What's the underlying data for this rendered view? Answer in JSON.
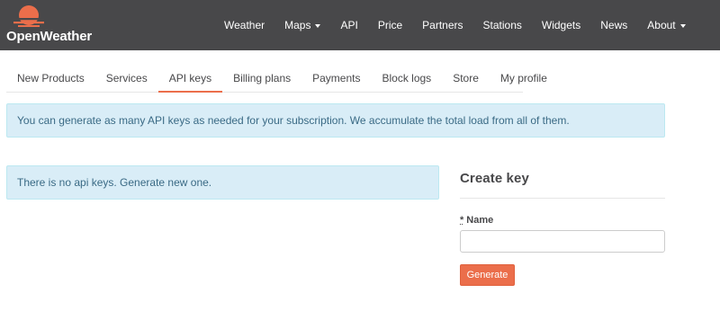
{
  "brand": {
    "name": "OpenWeather",
    "accent_color": "#eb6e4b",
    "header_bg": "#48484a"
  },
  "nav": {
    "items": [
      {
        "label": "Weather",
        "dropdown": false
      },
      {
        "label": "Maps",
        "dropdown": true
      },
      {
        "label": "API",
        "dropdown": false
      },
      {
        "label": "Price",
        "dropdown": false
      },
      {
        "label": "Partners",
        "dropdown": false
      },
      {
        "label": "Stations",
        "dropdown": false
      },
      {
        "label": "Widgets",
        "dropdown": false
      },
      {
        "label": "News",
        "dropdown": false
      },
      {
        "label": "About",
        "dropdown": true
      }
    ]
  },
  "tabs": {
    "active": "API keys",
    "items": [
      {
        "label": "New Products"
      },
      {
        "label": "Services"
      },
      {
        "label": "API keys"
      },
      {
        "label": "Billing plans"
      },
      {
        "label": "Payments"
      },
      {
        "label": "Block logs"
      },
      {
        "label": "Store"
      },
      {
        "label": "My profile"
      }
    ]
  },
  "info": {
    "subscription_note": "You can generate as many API keys as needed for your subscription. We accumulate the total load from all of them.",
    "no_keys": "There is no api keys. Generate new one."
  },
  "create_key": {
    "title": "Create key",
    "required_marker": "*",
    "name_label": "Name",
    "name_value": "",
    "generate_label": "Generate"
  }
}
